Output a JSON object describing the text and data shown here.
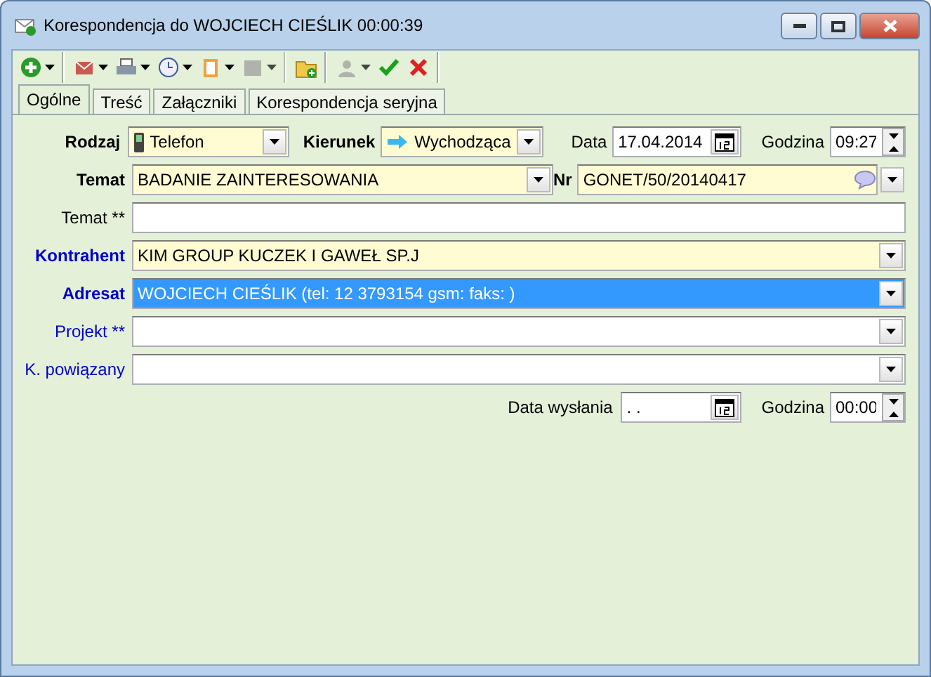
{
  "window": {
    "title": "Korespondencja do WOJCIECH CIEŚLIK 00:00:39"
  },
  "toolbar": [
    {
      "kind": "add",
      "dropdown": true,
      "disabled": false,
      "separator_after": true
    },
    {
      "kind": "mail",
      "dropdown": true,
      "disabled": false,
      "separator_after": false
    },
    {
      "kind": "print",
      "dropdown": true,
      "disabled": false,
      "separator_after": false
    },
    {
      "kind": "clock",
      "dropdown": true,
      "disabled": false,
      "separator_after": false
    },
    {
      "kind": "clipboard",
      "dropdown": true,
      "disabled": false,
      "separator_after": false
    },
    {
      "kind": "square",
      "dropdown": true,
      "disabled": true,
      "separator_after": true
    },
    {
      "kind": "folder",
      "dropdown": false,
      "disabled": false,
      "separator_after": true
    },
    {
      "kind": "person",
      "dropdown": true,
      "disabled": true,
      "separator_after": false
    },
    {
      "kind": "ok",
      "dropdown": false,
      "disabled": false,
      "separator_after": false
    },
    {
      "kind": "cancel",
      "dropdown": false,
      "disabled": false,
      "separator_after": true
    }
  ],
  "tabs": [
    {
      "label": "Ogólne",
      "selected": true
    },
    {
      "label": "Treść",
      "selected": false
    },
    {
      "label": "Załączniki",
      "selected": false
    },
    {
      "label": "Korespondencja seryjna",
      "selected": false
    }
  ],
  "rows": [
    {
      "fields": [
        {
          "kind": "combo",
          "label": "Rodzaj",
          "bold": true,
          "link": false,
          "value": "Telefon",
          "required": true,
          "selected": false
        },
        {
          "kind": "combo",
          "label": "Kierunek",
          "bold": true,
          "link": false,
          "value": "Wychodząca",
          "required": true,
          "selected": false
        },
        {
          "kind": "date",
          "label": "Data",
          "bold": false,
          "link": false,
          "value": "17.04.2014"
        },
        {
          "kind": "time",
          "label": "Godzina",
          "bold": false,
          "link": false,
          "value": "09:27"
        }
      ]
    },
    {
      "fields": [
        {
          "kind": "combo",
          "label": "Temat",
          "bold": true,
          "link": false,
          "value": "BADANIE ZAINTERESOWANIA",
          "required": true,
          "selected": false
        },
        {
          "kind": "number",
          "label": "Nr",
          "bold": true,
          "link": false,
          "value": "GONET/50/20140417",
          "required": true
        }
      ]
    },
    {
      "fields": [
        {
          "kind": "text",
          "label": "Temat **",
          "bold": false,
          "link": false,
          "required": false
        }
      ]
    },
    {
      "fields": [
        {
          "kind": "combo",
          "label": "Kontrahent",
          "bold": true,
          "link": true,
          "value": "KIM GROUP KUCZEK I GAWEŁ SP.J",
          "required": true,
          "selected": false
        }
      ]
    },
    {
      "fields": [
        {
          "kind": "combo",
          "label": "Adresat",
          "bold": true,
          "link": true,
          "value": "WOJCIECH CIEŚLIK (tel: 12 3793154 gsm:  faks: )",
          "selected": true
        }
      ]
    },
    {
      "fields": [
        {
          "kind": "combo",
          "label": "Projekt **",
          "bold": false,
          "link": true,
          "required": false,
          "selected": false
        }
      ]
    },
    {
      "fields": [
        {
          "kind": "combo",
          "label": "K. powiązany",
          "bold": false,
          "link": true,
          "required": false,
          "selected": false
        }
      ]
    },
    {
      "fields": [
        {
          "kind": "date",
          "label": "Data wysłania",
          "bold": false,
          "link": false,
          "value": ". ."
        },
        {
          "kind": "time",
          "label": "Godzina",
          "bold": false,
          "link": false,
          "value": "00:00"
        }
      ]
    }
  ]
}
